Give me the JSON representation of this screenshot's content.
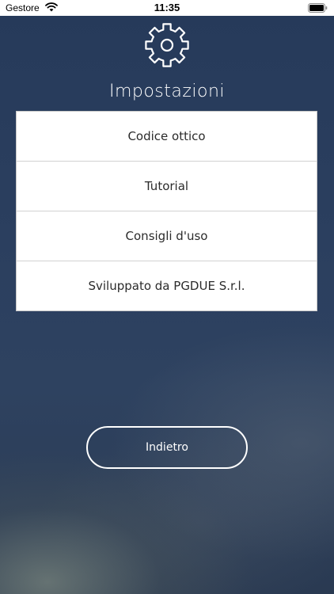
{
  "status_bar": {
    "carrier": "Gestore",
    "time": "11:35",
    "wifi_icon": "wifi-icon",
    "battery_icon": "battery-icon"
  },
  "header": {
    "icon": "gear-icon",
    "title": "Impostazioni"
  },
  "menu": {
    "items": [
      {
        "label": "Codice ottico"
      },
      {
        "label": "Tutorial"
      },
      {
        "label": "Consigli d'uso"
      },
      {
        "label": "Sviluppato da PGDUE S.r.l."
      }
    ]
  },
  "actions": {
    "back_label": "Indietro"
  },
  "colors": {
    "background_top": "#263a5a",
    "background_bottom": "#2a3a52",
    "menu_background": "#ffffff",
    "menu_text": "#2b2b2b",
    "foreground": "#ffffff"
  }
}
